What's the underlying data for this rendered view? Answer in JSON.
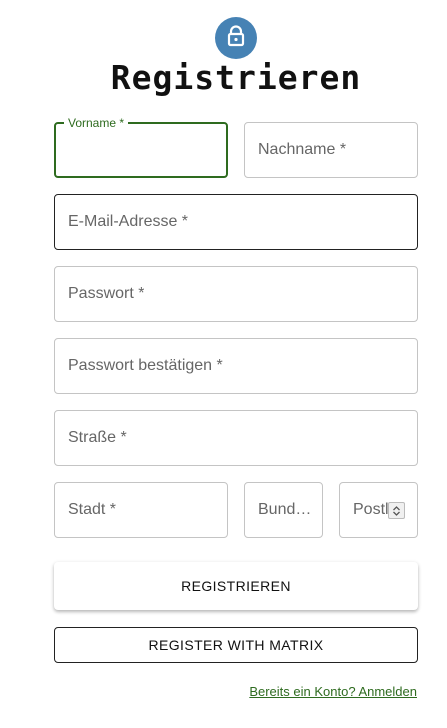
{
  "header": {
    "icon": "lock-icon",
    "title": "Registrieren",
    "accent_color": "#4682b4"
  },
  "form": {
    "first_name": {
      "label": "Vorname *",
      "value": ""
    },
    "last_name": {
      "label": "Nachname *",
      "value": ""
    },
    "email": {
      "label": "E-Mail-Adresse *",
      "value": ""
    },
    "password": {
      "label": "Passwort *",
      "value": ""
    },
    "password_confirm": {
      "label": "Passwort bestätigen *",
      "value": ""
    },
    "street": {
      "label": "Straße *",
      "value": ""
    },
    "city": {
      "label": "Stadt *",
      "value": ""
    },
    "state": {
      "label": "Bund…",
      "value": ""
    },
    "postal": {
      "label": "Postl",
      "value": ""
    }
  },
  "actions": {
    "register_label": "REGISTRIEREN",
    "matrix_label": "REGISTER WITH MATRIX",
    "login_link": "Bereits ein Konto? Anmelden"
  },
  "colors": {
    "focus": "#2e6b1f",
    "link": "#2e6b1f"
  }
}
